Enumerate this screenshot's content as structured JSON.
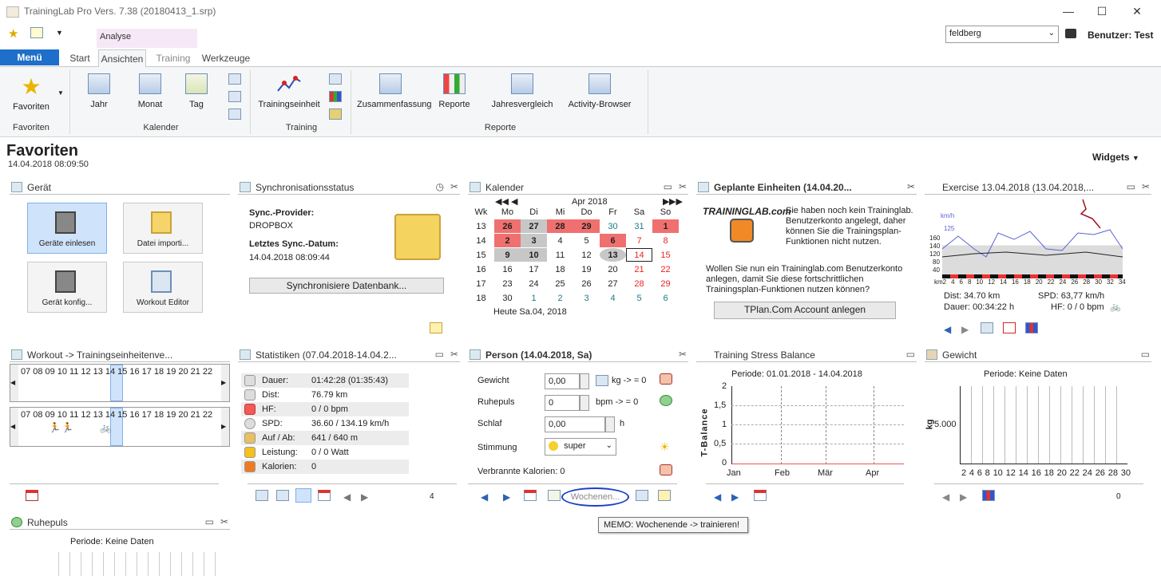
{
  "window": {
    "title": "TrainingLab Pro Vers. 7.38 (20180413_1.srp)"
  },
  "user": {
    "dropdown_value": "feldberg",
    "label": "Benutzer: Test"
  },
  "ribbon": {
    "context_tab": "Analyse",
    "menu": "Menü",
    "tabs": [
      "Start",
      "Ansichten",
      "Training",
      "Werkzeuge"
    ],
    "groups": {
      "favoriten": {
        "label": "Favoriten",
        "button": "Favoriten"
      },
      "kalender": {
        "label": "Kalender",
        "buttons": [
          "Jahr",
          "Monat",
          "Tag"
        ]
      },
      "training": {
        "label": "Training",
        "button": "Trainingseinheit"
      },
      "reporte": {
        "label": "Reporte",
        "buttons": [
          "Zusammenfassung",
          "Reporte",
          "Jahresvergleich",
          "Activity-Browser"
        ]
      }
    }
  },
  "page": {
    "title": "Favoriten",
    "date": "14.04.2018 08:09:50",
    "widgets": "Widgets"
  },
  "geraet": {
    "title": "Gerät",
    "tiles": [
      "Geräte einlesen",
      "Datei importi...",
      "Gerät konfig...",
      "Workout Editor"
    ]
  },
  "sync": {
    "title": "Synchronisationsstatus",
    "provider_label": "Sync.-Provider:",
    "provider": "DROPBOX",
    "last_label": "Letztes Sync.-Datum:",
    "last": "14.04.2018 08:09:44",
    "button": "Synchronisiere Datenbank..."
  },
  "kalender": {
    "title": "Kalender",
    "month": "Apr 2018",
    "headers": [
      "Wk",
      "Mo",
      "Di",
      "Mi",
      "Do",
      "Fr",
      "Sa",
      "So"
    ],
    "rows": [
      [
        "13",
        "26",
        "27",
        "28",
        "29",
        "30",
        "31",
        "1"
      ],
      [
        "14",
        "2",
        "3",
        "4",
        "5",
        "6",
        "7",
        "8"
      ],
      [
        "15",
        "9",
        "10",
        "11",
        "12",
        "13",
        "14",
        "15"
      ],
      [
        "16",
        "16",
        "17",
        "18",
        "19",
        "20",
        "21",
        "22"
      ],
      [
        "17",
        "23",
        "24",
        "25",
        "26",
        "27",
        "28",
        "29"
      ],
      [
        "18",
        "30",
        "1",
        "2",
        "3",
        "4",
        "5",
        "6"
      ]
    ],
    "today": "Heute Sa.04, 2018"
  },
  "geplant": {
    "title": "Geplante Einheiten (14.04.20...",
    "logo": "TRAININGLAB.com",
    "text1": "Sie haben noch kein Traininglab. Benutzerkonto angelegt, daher können Sie die Trainingsplan-Funktionen nicht nutzen.",
    "text2": "Wollen Sie nun ein Traininglab.com Benutzerkonto anlegen, damit Sie diese fortschrittlichen Trainingsplan-Funktionen nutzen können?",
    "button": "TPlan.Com Account anlegen"
  },
  "exercise": {
    "title": "Exercise 13.04.2018 (13.04.2018,...",
    "unit": "km/h",
    "y_ticks": [
      "125",
      "160",
      "140",
      "120",
      "80",
      "40"
    ],
    "x_ticks": [
      "km2",
      "4",
      "6",
      "8",
      "10",
      "12",
      "14",
      "16",
      "18",
      "20",
      "22",
      "24",
      "26",
      "28",
      "30",
      "32",
      "34"
    ],
    "dist": "Dist: 34.70 km",
    "spd": "SPD: 63,77 km/h",
    "dauer": "Dauer: 00:34:22 h",
    "hf": "HF: 0 / 0 bpm"
  },
  "workout": {
    "title": "Workout -> Trainingseinheitenve...",
    "hours": [
      "07",
      "08",
      "09",
      "10",
      "11",
      "12",
      "13",
      "14",
      "15",
      "16",
      "17",
      "18",
      "19",
      "20",
      "21",
      "22"
    ]
  },
  "statistiken": {
    "title": "Statistiken (07.04.2018-14.04.2...",
    "rows": [
      {
        "label": "Dauer:",
        "value": "01:42:28 (01:35:43)"
      },
      {
        "label": "Dist:",
        "value": "76.79 km"
      },
      {
        "label": "HF:",
        "value": "0 / 0 bpm"
      },
      {
        "label": "SPD:",
        "value": "36.60 / 134.19 km/h"
      },
      {
        "label": "Auf / Ab:",
        "value": "641 / 640 m"
      },
      {
        "label": "Leistung:",
        "value": "0 / 0 Watt"
      },
      {
        "label": "Kalorien:",
        "value": "0"
      }
    ],
    "footer_count": "4"
  },
  "person": {
    "title": "Person (14.04.2018, Sa)",
    "gewicht_label": "Gewicht",
    "gewicht": "0,00",
    "gewicht_unit": "kg -> = 0",
    "ruhepuls_label": "Ruhepuls",
    "ruhepuls": "0",
    "ruhepuls_unit": "bpm -> = 0",
    "schlaf_label": "Schlaf",
    "schlaf": "0,00",
    "schlaf_unit": "h",
    "stimmung_label": "Stimmung",
    "stimmung": "super",
    "kalorien": "Verbrannte Kalorien: 0",
    "memo_placeholder": "Wochenen..."
  },
  "tooltip": "MEMO: Wochenende -> trainieren!",
  "tsb": {
    "title": "Training Stress Balance",
    "period": "Periode: 01.01.2018 - 14.04.2018",
    "ylabel": "T-Balance",
    "y_ticks": [
      "2",
      "1,5",
      "1",
      "0,5",
      "0"
    ],
    "x_ticks": [
      "Jan",
      "Feb",
      "Mär",
      "Apr"
    ]
  },
  "gewicht": {
    "title": "Gewicht",
    "period": "Periode: Keine Daten",
    "ylabel": "kg",
    "y_tick": "5.000",
    "x_ticks": [
      "2",
      "4",
      "6",
      "8",
      "10",
      "12",
      "14",
      "16",
      "18",
      "20",
      "22",
      "24",
      "26",
      "28",
      "30"
    ],
    "footer_count": "0"
  },
  "ruhepuls": {
    "title": "Ruhepuls",
    "period": "Periode: Keine Daten"
  }
}
